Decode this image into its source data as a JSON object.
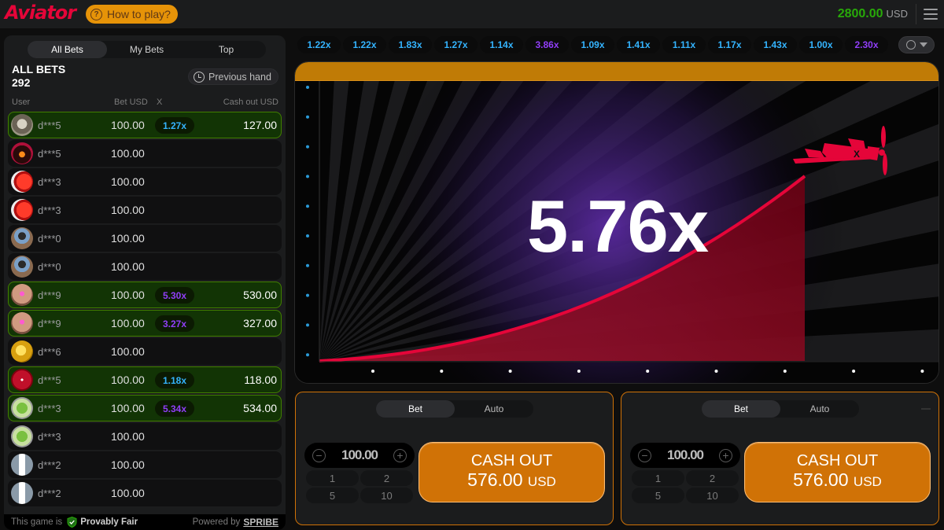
{
  "header": {
    "logo": "Aviator",
    "how_to_play": "How to play?",
    "balance": "2800.00",
    "currency": "USD"
  },
  "bets_panel": {
    "tabs": [
      {
        "label": "All Bets",
        "active": true
      },
      {
        "label": "My Bets",
        "active": false
      },
      {
        "label": "Top",
        "active": false
      }
    ],
    "title": "ALL BETS",
    "count": "292",
    "previous_hand": "Previous hand",
    "columns": {
      "user": "User",
      "bet": "Bet USD",
      "x": "X",
      "cashout": "Cash out USD"
    },
    "rows": [
      {
        "user": "d***5",
        "bet": "100.00",
        "mult": "1.27x",
        "cashout": "127.00",
        "win": true,
        "mult_color": "#34b4ff",
        "avatar": "raccoon"
      },
      {
        "user": "d***5",
        "bet": "100.00",
        "mult": "",
        "cashout": "",
        "win": false,
        "avatar": "masked"
      },
      {
        "user": "d***3",
        "bet": "100.00",
        "mult": "",
        "cashout": "",
        "win": false,
        "avatar": "red-car"
      },
      {
        "user": "d***3",
        "bet": "100.00",
        "mult": "",
        "cashout": "",
        "win": false,
        "avatar": "red-car"
      },
      {
        "user": "d***0",
        "bet": "100.00",
        "mult": "",
        "cashout": "",
        "win": false,
        "avatar": "person"
      },
      {
        "user": "d***0",
        "bet": "100.00",
        "mult": "",
        "cashout": "",
        "win": false,
        "avatar": "person"
      },
      {
        "user": "d***9",
        "bet": "100.00",
        "mult": "5.30x",
        "cashout": "530.00",
        "win": true,
        "mult_color": "#913ef8",
        "avatar": "bald-glasses"
      },
      {
        "user": "d***9",
        "bet": "100.00",
        "mult": "3.27x",
        "cashout": "327.00",
        "win": true,
        "mult_color": "#913ef8",
        "avatar": "bald-glasses"
      },
      {
        "user": "d***6",
        "bet": "100.00",
        "mult": "",
        "cashout": "",
        "win": false,
        "avatar": "gold"
      },
      {
        "user": "d***5",
        "bet": "100.00",
        "mult": "1.18x",
        "cashout": "118.00",
        "win": true,
        "mult_color": "#34b4ff",
        "avatar": "dice"
      },
      {
        "user": "d***3",
        "bet": "100.00",
        "mult": "5.34x",
        "cashout": "534.00",
        "win": true,
        "mult_color": "#913ef8",
        "avatar": "clover"
      },
      {
        "user": "d***3",
        "bet": "100.00",
        "mult": "",
        "cashout": "",
        "win": false,
        "avatar": "clover"
      },
      {
        "user": "d***2",
        "bet": "100.00",
        "mult": "",
        "cashout": "",
        "win": false,
        "avatar": "plane"
      },
      {
        "user": "d***2",
        "bet": "100.00",
        "mult": "",
        "cashout": "",
        "win": false,
        "avatar": "plane"
      }
    ],
    "footer": {
      "this_game_is": "This game is",
      "provably_fair": "Provably Fair",
      "powered_by": "Powered by",
      "brand": "SPRIBE"
    }
  },
  "history": [
    {
      "value": "1.22x",
      "color": "#34b4ff"
    },
    {
      "value": "1.22x",
      "color": "#34b4ff"
    },
    {
      "value": "1.83x",
      "color": "#34b4ff"
    },
    {
      "value": "1.27x",
      "color": "#34b4ff"
    },
    {
      "value": "1.14x",
      "color": "#34b4ff"
    },
    {
      "value": "3.86x",
      "color": "#913ef8"
    },
    {
      "value": "1.09x",
      "color": "#34b4ff"
    },
    {
      "value": "1.41x",
      "color": "#34b4ff"
    },
    {
      "value": "1.11x",
      "color": "#34b4ff"
    },
    {
      "value": "1.17x",
      "color": "#34b4ff"
    },
    {
      "value": "1.43x",
      "color": "#34b4ff"
    },
    {
      "value": "1.00x",
      "color": "#34b4ff"
    },
    {
      "value": "2.30x",
      "color": "#913ef8"
    }
  ],
  "game": {
    "multiplier": "5.76x"
  },
  "bet_panels": [
    {
      "tabs": [
        {
          "label": "Bet",
          "active": true
        },
        {
          "label": "Auto",
          "active": false
        }
      ],
      "amount": "100.00",
      "quick": [
        "1",
        "2",
        "5",
        "10"
      ],
      "cashout_label": "CASH OUT",
      "cashout_amount": "576.00",
      "currency": "USD"
    },
    {
      "tabs": [
        {
          "label": "Bet",
          "active": true
        },
        {
          "label": "Auto",
          "active": false
        }
      ],
      "amount": "100.00",
      "quick": [
        "1",
        "2",
        "5",
        "10"
      ],
      "cashout_label": "CASH OUT",
      "cashout_amount": "576.00",
      "currency": "USD"
    }
  ],
  "colors": {
    "brand_red": "#e50539",
    "accent_orange": "#d07206",
    "win_green": "#28a909",
    "blue_mult": "#34b4ff",
    "purple_mult": "#913ef8"
  }
}
